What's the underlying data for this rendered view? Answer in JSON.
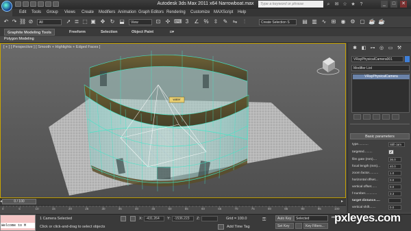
{
  "window": {
    "title": "Autodesk 3ds Max  2011 x64      Narrowboat.max",
    "search_placeholder": "Type a keyword or phrase"
  },
  "menu": [
    "Edit",
    "Tools",
    "Group",
    "Views",
    "Create",
    "Modifiers",
    "Animation",
    "Graph Editors",
    "Rendering",
    "Customize",
    "MAXScript",
    "Help"
  ],
  "toolbar": {
    "filter_select": "All",
    "view_select": "View",
    "selection_set": "Create Selection S"
  },
  "ribbon": {
    "tabs": [
      "Graphite Modeling Tools",
      "Freeform",
      "Selection",
      "Object Paint"
    ],
    "sub_label": "Polygon Modeling"
  },
  "viewport": {
    "label": "[ + ] [ Perspective ] [ Smooth + Highlights + Edged Faces ]",
    "object_label": "water"
  },
  "command_panel": {
    "object_name": "VRayPhysicalCamera001",
    "modifier_list": "Modifier List",
    "stack_item": "VRayPhysicalCamera",
    "rollout_title": "Basic parameters",
    "params": [
      {
        "label": "type...........",
        "value": "Still cam"
      },
      {
        "label": "targeted.........",
        "value": "✔"
      },
      {
        "label": "film gate (mm)....",
        "value": "36.0"
      },
      {
        "label": "focal length (mm)...",
        "value": "40.0"
      },
      {
        "label": "zoom factor..........",
        "value": "1.0"
      },
      {
        "label": "horizontal offset...",
        "value": "0.0"
      },
      {
        "label": "vertical offset......",
        "value": "0.0"
      },
      {
        "label": "f-number.............",
        "value": "3.3"
      },
      {
        "label": "target distance.....",
        "value": ""
      },
      {
        "label": "vertical shift.......",
        "value": "0.0"
      }
    ],
    "accent_color": "#3f7fd8"
  },
  "timeline": {
    "frame": "0 / 100",
    "ticks": [
      "0",
      "5",
      "10",
      "15",
      "20",
      "25",
      "30",
      "35",
      "40",
      "45",
      "50",
      "55",
      "60",
      "65",
      "70",
      "75",
      "80",
      "85",
      "90",
      "95",
      "100"
    ]
  },
  "status": {
    "maxscript": "Welcome to M",
    "selection_info": "1 Camera Selected",
    "prompt": "Click or click-and-drag to select objects",
    "x_label": "X:",
    "x_value": "-431.264",
    "y_label": "Y:",
    "y_value": "-1536.223",
    "z_label": "Z:",
    "grid": "Grid = 100.0",
    "add_time_tag": "Add Time Tag",
    "auto_key": "Auto Key",
    "auto_key_mode": "Selected",
    "set_key": "Set Key",
    "key_filters": "Key Filters..."
  },
  "watermark": "pxleyes.com",
  "colors": {
    "viewport_border": "#c9a400",
    "wireframe": "#3fe8c8",
    "selection_bounds": "#ffffff"
  }
}
